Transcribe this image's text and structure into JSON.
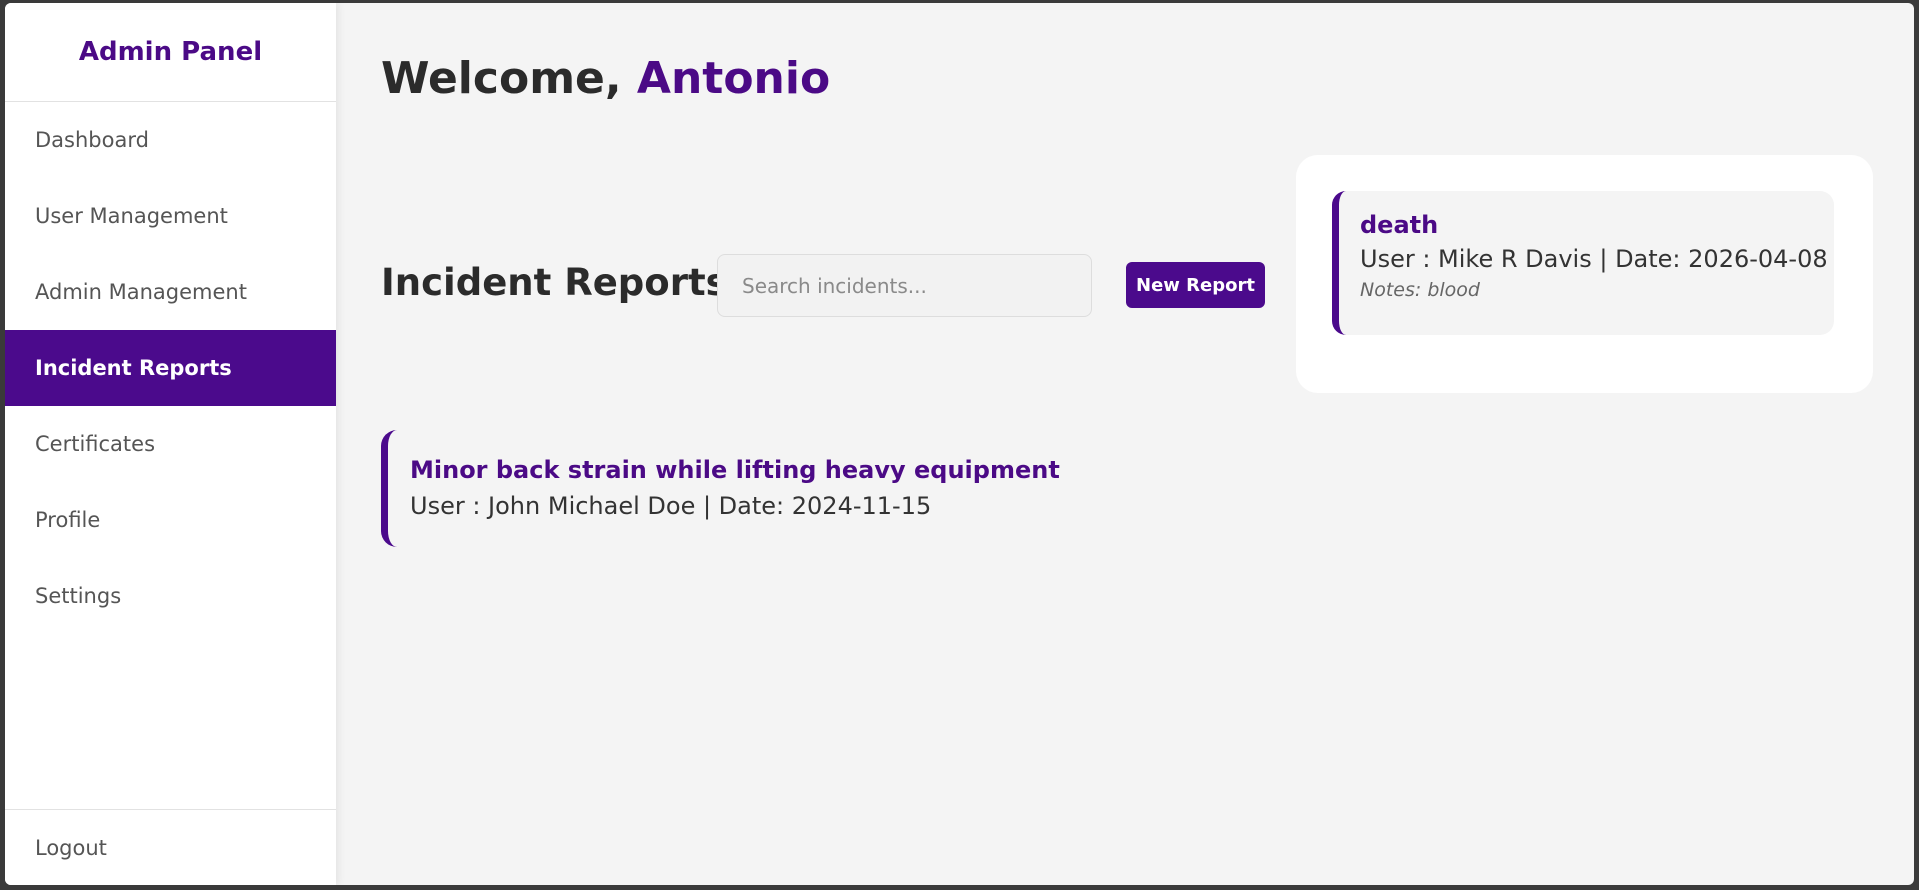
{
  "sidebar": {
    "brand": "Admin Panel",
    "items": [
      {
        "label": "Dashboard"
      },
      {
        "label": "User Management"
      },
      {
        "label": "Admin Management"
      },
      {
        "label": "Incident Reports"
      },
      {
        "label": "Certificates"
      },
      {
        "label": "Profile"
      },
      {
        "label": "Settings"
      }
    ],
    "active_index": 3,
    "logout": "Logout"
  },
  "header": {
    "welcome": "Welcome, ",
    "user_name": "Antonio"
  },
  "incidents": {
    "title": "Incident Reports",
    "search_placeholder": "Search incidents...",
    "new_button": "New Report",
    "highlighted": {
      "title": "death",
      "meta": "User : Mike R Davis | Date: 2026-04-08",
      "notes": "Notes: blood"
    },
    "list": [
      {
        "title": "Minor back strain while lifting heavy equipment",
        "meta": "User : John Michael Doe | Date: 2024-11-15"
      }
    ]
  },
  "colors": {
    "accent": "#4b0a8c",
    "background": "#f4f4f4",
    "sidebar": "#ffffff"
  }
}
